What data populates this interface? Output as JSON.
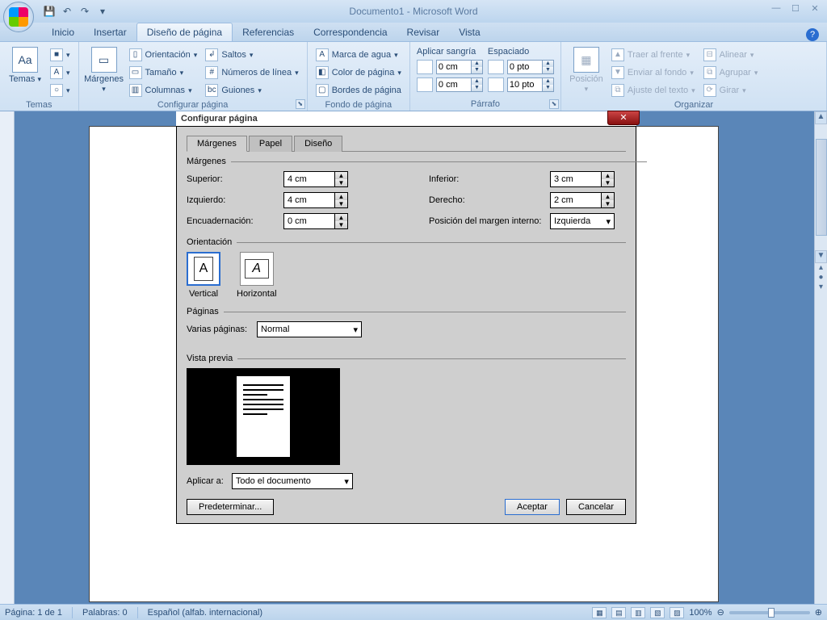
{
  "titlebar": {
    "title": "Documento1 - Microsoft Word"
  },
  "tabs": {
    "inicio": "Inicio",
    "insertar": "Insertar",
    "diseno": "Diseño de página",
    "referencias": "Referencias",
    "correspondencia": "Correspondencia",
    "revisar": "Revisar",
    "vista": "Vista"
  },
  "ribbon": {
    "temas": {
      "label": "Temas",
      "btn": "Temas"
    },
    "configurar": {
      "label": "Configurar página",
      "margenes": "Márgenes",
      "orientacion": "Orientación",
      "tamano": "Tamaño",
      "columnas": "Columnas",
      "saltos": "Saltos",
      "numeros": "Números de línea",
      "guiones": "Guiones"
    },
    "fondo": {
      "label": "Fondo de página",
      "marca": "Marca de agua",
      "color": "Color de página",
      "bordes": "Bordes de página"
    },
    "parrafo": {
      "label": "Párrafo",
      "sangria": "Aplicar sangría",
      "espaciado": "Espaciado",
      "left": "0 cm",
      "right": "0 cm",
      "before": "0 pto",
      "after": "10 pto"
    },
    "organizar": {
      "label": "Organizar",
      "posicion": "Posición",
      "traer": "Traer al frente",
      "enviar": "Enviar al fondo",
      "ajuste": "Ajuste del texto",
      "alinear": "Alinear",
      "agrupar": "Agrupar",
      "girar": "Girar"
    }
  },
  "dialog": {
    "title": "Configurar página",
    "tabs": {
      "margenes": "Márgenes",
      "papel": "Papel",
      "diseno": "Diseño"
    },
    "margenes_section": "Márgenes",
    "fields": {
      "superior": "Superior:",
      "superior_v": "4 cm",
      "inferior": "Inferior:",
      "inferior_v": "3 cm",
      "izquierdo": "Izquierdo:",
      "izquierdo_v": "4 cm",
      "derecho": "Derecho:",
      "derecho_v": "2 cm",
      "encuad": "Encuadernación:",
      "encuad_v": "0 cm",
      "posicion": "Posición del margen interno:",
      "posicion_v": "Izquierda"
    },
    "orientacion": {
      "label": "Orientación",
      "vertical": "Vertical",
      "horizontal": "Horizontal"
    },
    "paginas": {
      "label": "Páginas",
      "varias": "Varias páginas:",
      "value": "Normal"
    },
    "vista": {
      "label": "Vista previa",
      "aplicar": "Aplicar a:",
      "aplicar_v": "Todo el documento"
    },
    "buttons": {
      "predet": "Predeterminar...",
      "aceptar": "Aceptar",
      "cancelar": "Cancelar"
    }
  },
  "status": {
    "pagina": "Página: 1 de 1",
    "palabras": "Palabras: 0",
    "idioma": "Español (alfab. internacional)",
    "zoom": "100%"
  }
}
